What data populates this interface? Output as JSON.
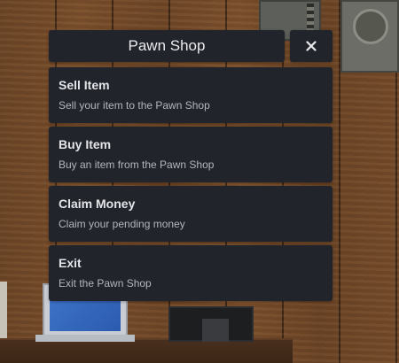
{
  "menu": {
    "title": "Pawn Shop",
    "close_icon": "close-icon",
    "items": [
      {
        "label": "Sell Item",
        "description": "Sell your item to the Pawn Shop"
      },
      {
        "label": "Buy Item",
        "description": "Buy an item from the Pawn Shop"
      },
      {
        "label": "Claim Money",
        "description": "Claim your pending money"
      },
      {
        "label": "Exit",
        "description": "Exit the Pawn Shop"
      }
    ]
  },
  "colors": {
    "panel_bg": "#22242b",
    "title_text": "#e9eaee",
    "description_text": "#b4b6bd"
  }
}
